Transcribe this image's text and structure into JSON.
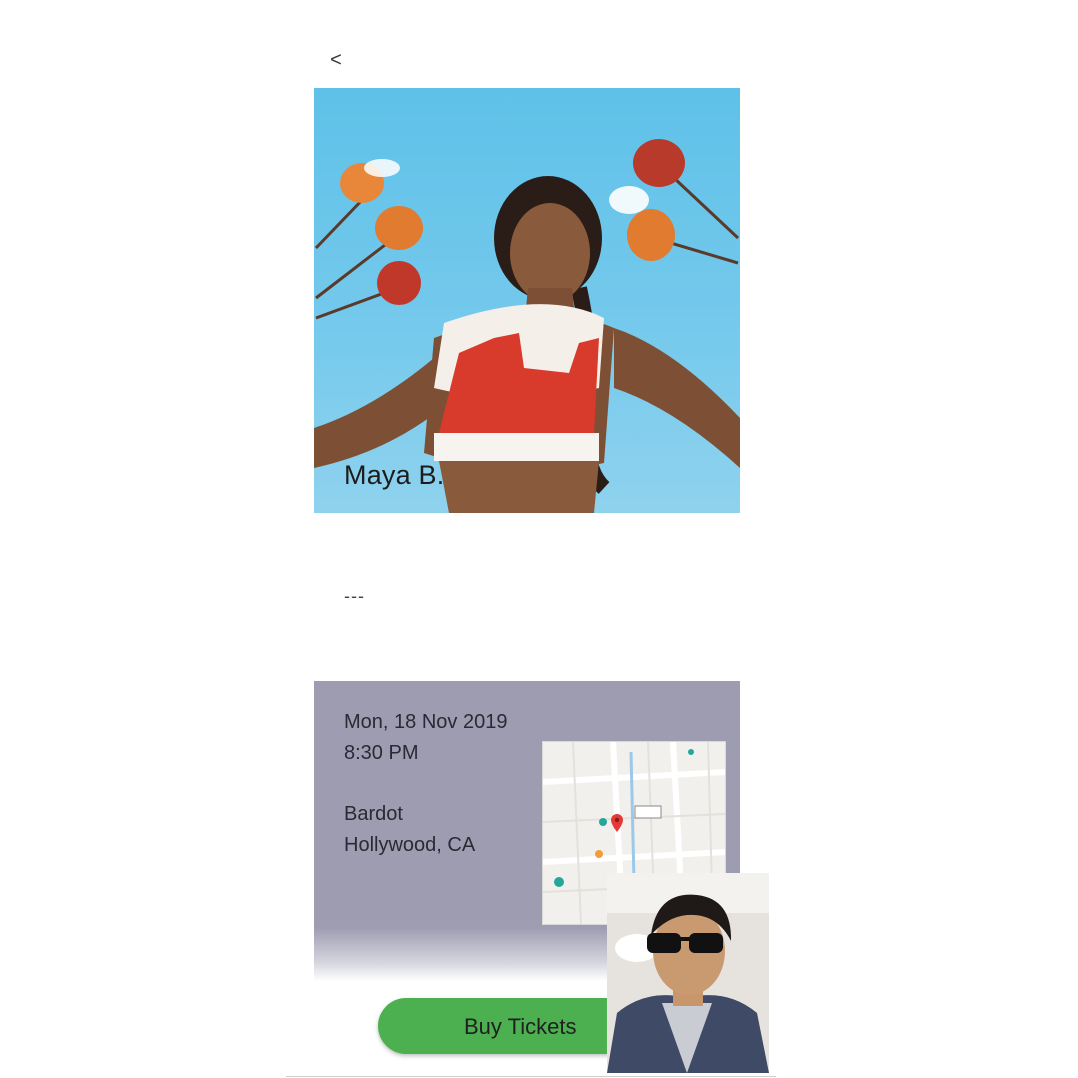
{
  "nav": {
    "back_label": "<"
  },
  "artist": {
    "name": "Maya B."
  },
  "divider": {
    "text": "---"
  },
  "event": {
    "date": "Mon, 18 Nov 2019",
    "time": "8:30 PM",
    "venue": "Bardot",
    "location": "Hollywood, CA"
  },
  "actions": {
    "buy_label": "Buy Tickets"
  },
  "colors": {
    "accent_green": "#4caf50",
    "card_gray": "#9d9cb0",
    "hero_sky": "#5fc1e8"
  },
  "icons": {
    "back": "chevron-left-icon",
    "map_pin": "map-pin-icon"
  }
}
